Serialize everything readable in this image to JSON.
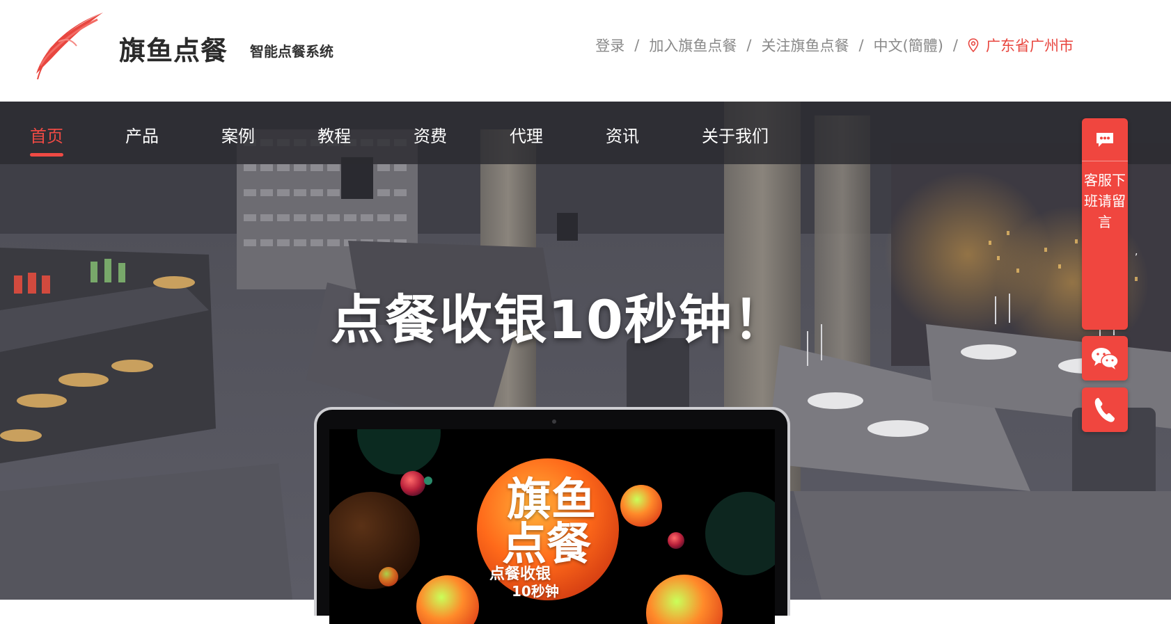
{
  "header": {
    "brand_name": "旗鱼点餐",
    "slogan": "智能点餐系统",
    "links": {
      "login": "登录",
      "join": "加入旗鱼点餐",
      "follow": "关注旗鱼点餐",
      "language": "中文(簡體)",
      "separator": "/",
      "location": "广东省广州市"
    }
  },
  "nav": {
    "items": [
      {
        "label": "首页",
        "active": true
      },
      {
        "label": "产品"
      },
      {
        "label": "案例"
      },
      {
        "label": "教程"
      },
      {
        "label": "资费"
      },
      {
        "label": "代理"
      },
      {
        "label": "资讯"
      },
      {
        "label": "关于我们"
      }
    ]
  },
  "hero": {
    "headline": "点餐收银10秒钟！",
    "screen": {
      "brand_line1": "旗鱼",
      "brand_line2": "点餐",
      "tagline1": "点餐收银",
      "tagline2": "10秒钟"
    }
  },
  "side": {
    "chat_text": "客服下班请留言",
    "mark": ","
  },
  "colors": {
    "accent": "#ef4a44",
    "widget": "#f0463f",
    "nav_bg": "#2a2a30",
    "orange": "#ff7a1a"
  },
  "icons": [
    "logo-mark",
    "location-pin-icon",
    "chat-bubble-icon",
    "wechat-icon",
    "phone-icon"
  ]
}
